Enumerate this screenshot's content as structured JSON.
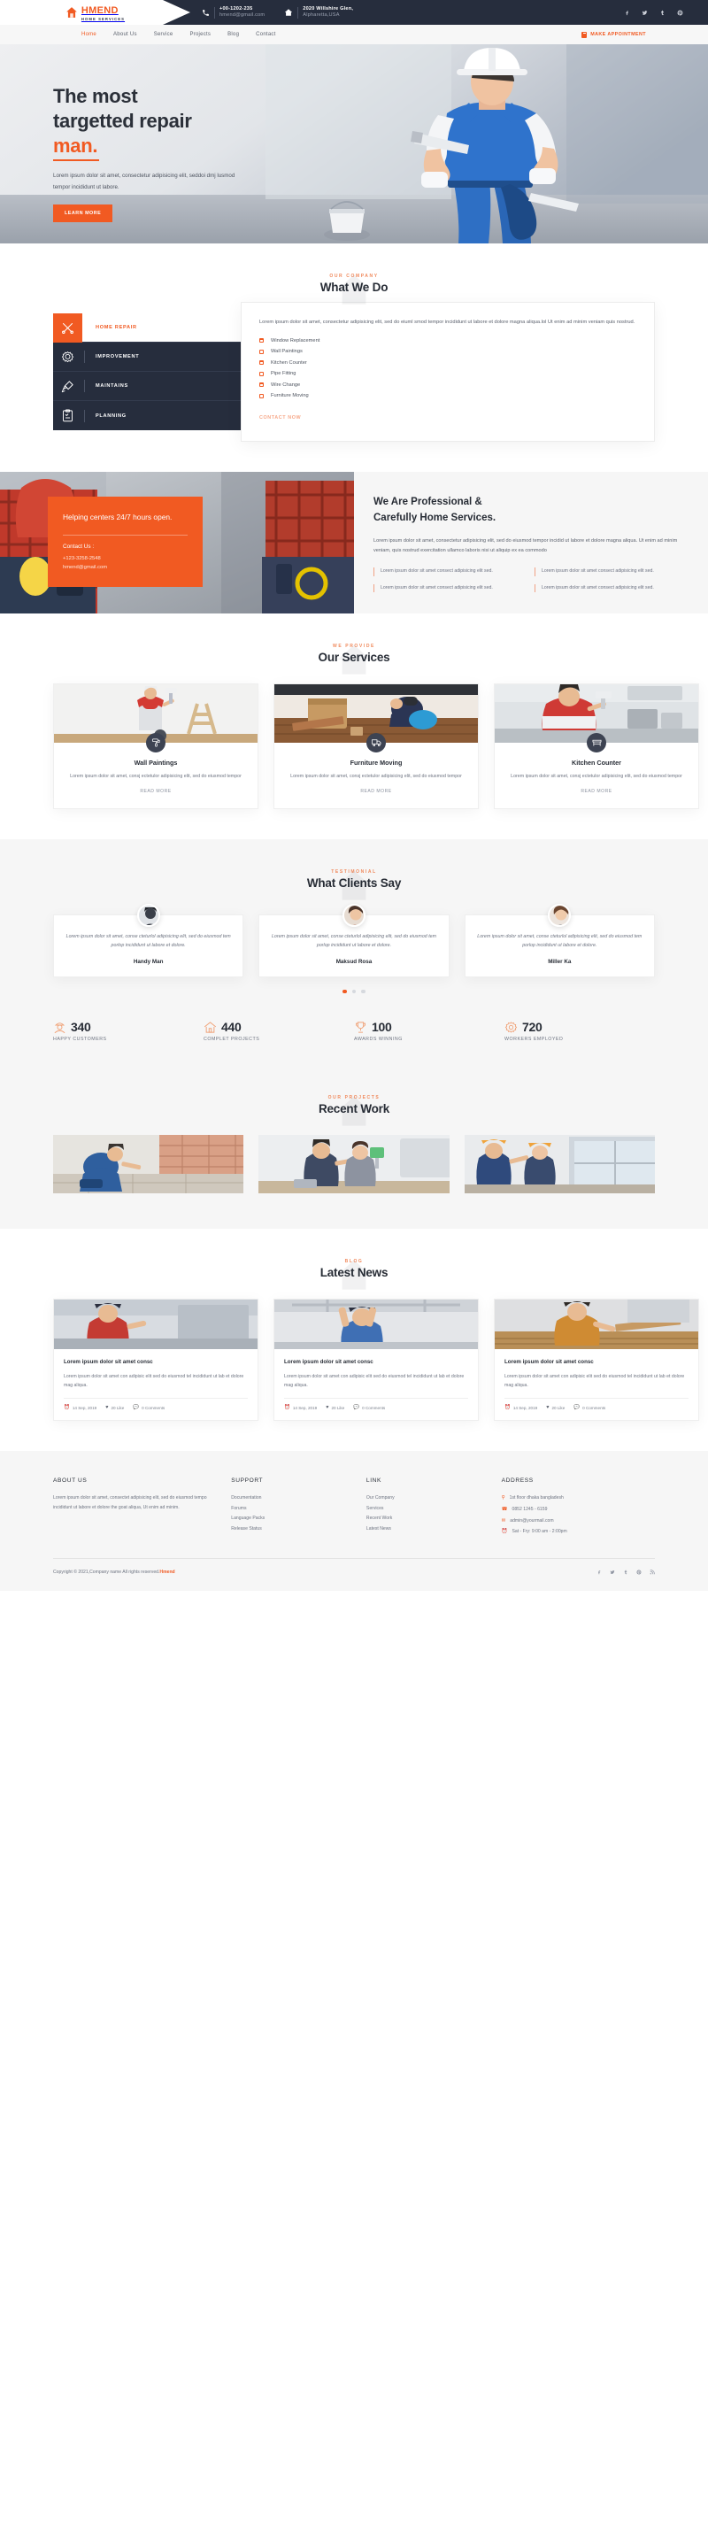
{
  "brand": {
    "name": "HMEND",
    "tagline": "HOME SERVICES",
    "accent": "#f15a22",
    "dark": "#262d3d"
  },
  "topbar": {
    "phone": "+00-1202-235",
    "email": "hmend@gmail.com",
    "address_line1": "2020 Willshire Glen,",
    "address_line2": "Alpharetta,USA",
    "socials": [
      "facebook",
      "twitter",
      "tumblr",
      "pinterest"
    ]
  },
  "nav": {
    "items": [
      {
        "label": "Home",
        "active": true
      },
      {
        "label": "About Us",
        "active": false
      },
      {
        "label": "Service",
        "active": false
      },
      {
        "label": "Projects",
        "active": false
      },
      {
        "label": "Blog",
        "active": false
      },
      {
        "label": "Contact",
        "active": false
      }
    ],
    "cta": "MAKE APPOINTMENT"
  },
  "hero": {
    "title_line1": "The most",
    "title_line2": "targetted repair",
    "title_accent": "man.",
    "desc": "Lorem ipsum dolor sit amet, consectetur adipisicing elit, seddoi dmj lusmod tempor incididunt ut labore.",
    "button": "LEARN MORE"
  },
  "what_we_do": {
    "sup": "OUR COMPANY",
    "title": "What We Do",
    "tabs": [
      {
        "label": "HOME REPAIR",
        "icon": "tools-icon",
        "active": true
      },
      {
        "label": "IMPROVEMENT",
        "icon": "gear-icon",
        "active": false
      },
      {
        "label": "MAINTAINS",
        "icon": "brush-icon",
        "active": false
      },
      {
        "label": "PLANNING",
        "icon": "clipboard-icon",
        "active": false
      }
    ],
    "panel_text": "Lorem ipsum dolor sit amet, consectetur adipisicing elit, sed do eiuml smod tempor incididunt ut labore et dolore magna aliqua.lol Ut enim ad minim veniam quis nostrud.",
    "list": [
      "Window Replacement",
      "Wall Paintings",
      "Kitchen Counter",
      "Pipe Fitting",
      "Wire Change",
      "Furniture Moving"
    ],
    "link": "CONTACT NOW"
  },
  "professional": {
    "card_title": "Helping centers 24/7 hours open.",
    "contact_label": "Contact Us :",
    "contact_phone": "+123-3258-2548",
    "contact_email": "hmend@gmail.com",
    "title_line1": "We Are Professional &",
    "title_line2": "Carefully Home Services.",
    "desc": "Lorem ipsum dolor sit amet, consectetur adipisicing elit, sed do eiusmod tempor incidid ut labore et dolore magna aliqua. Ut enim ad minim veniam, quis nostrud exercitation ullamco laboris nisi ut aliquip ex ea commodo",
    "points": [
      "Lorem ipsum dolor sit amet consect adipisicing elit sed.",
      "Lorem ipsum dolor sit amet consect adipisicing elit sed.",
      "Lorem ipsum dolor sit amet consect adipisicing elit sed.",
      "Lorem ipsum dolor sit amet consect adipisicing elit sed."
    ]
  },
  "services": {
    "sup": "WE PROVIDE",
    "title": "Our Services",
    "cards": [
      {
        "title": "Wall Paintings",
        "desc": "Lorem ipsum dolor sit amet, consj ectetulor adipisicing elit, sed do eiusmod tempor",
        "more": "READ MORE",
        "icon": "paint-roller-icon"
      },
      {
        "title": "Furniture Moving",
        "desc": "Lorem ipsum dolor sit amet, consj ectetulor adipisicing elit, sed do eiusmod tempor",
        "more": "READ MORE",
        "icon": "truck-icon"
      },
      {
        "title": "Kitchen Counter",
        "desc": "Lorem ipsum dolor sit amet, consj ectetulor adipisicing elit, sed do eiusmod tempor",
        "more": "READ MORE",
        "icon": "counter-icon"
      }
    ]
  },
  "testimonials": {
    "sup": "TESTIMONIAL",
    "title": "What Clients Say",
    "cards": [
      {
        "quote": "Lorem ipsum dolor sit amet, conse cteturlol adipisicing elit, sed do eiusmod tem porlop incididunt ut labore et dolore.",
        "name": "Handy Man"
      },
      {
        "quote": "Lorem ipsum dolor sit amet, conse cteturlol adipisicing elit, sed do eiusmod tem porlop incididunt ut labore et dolore.",
        "name": "Maksud Rosa"
      },
      {
        "quote": "Lorem ipsum dolor sit amet, conse cteturlol adipisicing elit, sed do eiusmod tem porlop incididunt ut labore et dolore.",
        "name": "Miller Ka"
      }
    ],
    "dots": 3,
    "active_dot": 0
  },
  "counters": [
    {
      "value": "340",
      "label": "HAPPY CUSTOMERS",
      "icon": "worker-icon"
    },
    {
      "value": "440",
      "label": "COMPLET PROJECTS",
      "icon": "house-icon"
    },
    {
      "value": "100",
      "label": "AWARDS WINNING",
      "icon": "trophy-icon"
    },
    {
      "value": "720",
      "label": "WORKERS EMPLOYED",
      "icon": "gear-icon"
    }
  ],
  "recent_work": {
    "sup": "OUR PROJECTS",
    "title": "Recent Work",
    "items": [
      "project-tiling",
      "project-painting",
      "project-window"
    ]
  },
  "news": {
    "sup": "BLOG",
    "title": "Latest News",
    "cards": [
      {
        "title": "Lorem ipsum dolor sit amet consc",
        "desc": "Lorem ipsum dolor sit amet con adipisic elit sed do eiusmod tel incididunt ut lab et dolore mag aliqua.",
        "date": "14 Sep, 2019",
        "likes": "20 Like",
        "comments": "0 Comments"
      },
      {
        "title": "Lorem ipsum dolor sit amet consc",
        "desc": "Lorem ipsum dolor sit amet con adipisic elit sed do eiusmod tel incididunt ut lab et dolore mag aliqua.",
        "date": "14 Sep, 2019",
        "likes": "20 Like",
        "comments": "0 Comments"
      },
      {
        "title": "Lorem ipsum dolor sit amet consc",
        "desc": "Lorem ipsum dolor sit amet con adipisic elit sed do eiusmod tel incididunt ut lab et dolore mag aliqua.",
        "date": "14 Sep, 2019",
        "likes": "20 Like",
        "comments": "0 Comments"
      }
    ]
  },
  "footer": {
    "about": {
      "heading": "ABOUT US",
      "text": "Lorem ipsum dolor sit amet, consectet adipisicing elit, sed do eiusmod tempo incididunt ut labore et dolore the goat aliqua, Ut enim ad minim."
    },
    "support": {
      "heading": "SUPPORT",
      "links": [
        "Documentation",
        "Forums",
        "Language Packs",
        "Release Status"
      ]
    },
    "link": {
      "heading": "LINK",
      "links": [
        "Our Company",
        "Services",
        "Recent Work",
        "Latest News"
      ]
    },
    "address": {
      "heading": "ADDRESS",
      "items": [
        {
          "icon": "location-icon",
          "text": "1st floor dhaka bangladesh"
        },
        {
          "icon": "phone-icon",
          "text": "0852 1245 - 6159"
        },
        {
          "icon": "mail-icon",
          "text": "admin@yourmail.com"
        },
        {
          "icon": "clock-icon",
          "text": "Sat - Fry: 9:00 am - 2:00pm"
        }
      ]
    },
    "copyright_pre": "Copyright © 2021,Company name All rights reserved.",
    "copyright_brand": "Hmend",
    "socials": [
      "facebook",
      "twitter",
      "tumblr",
      "pinterest",
      "rss"
    ]
  }
}
